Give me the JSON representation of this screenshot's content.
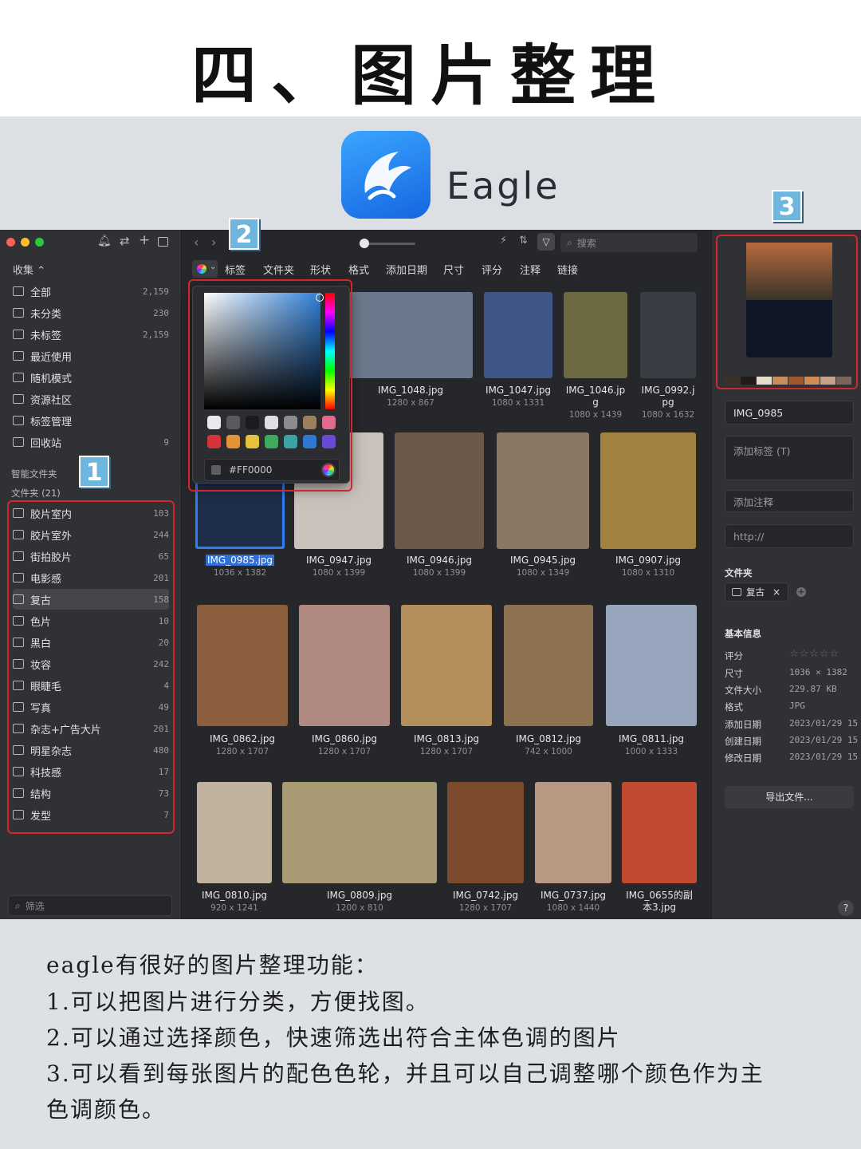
{
  "heading": "四、图片整理",
  "app_name": "Eagle",
  "badges": [
    "1",
    "2",
    "3"
  ],
  "toolbar": {
    "search_placeholder": "搜索"
  },
  "filters": [
    "标签",
    "文件夹",
    "形状",
    "格式",
    "添加日期",
    "尺寸",
    "评分",
    "注释",
    "链接"
  ],
  "color_picker": {
    "hex_value": "#FF0000",
    "swatches": [
      "#e9e9ea",
      "#595a5e",
      "#1c1c1e",
      "#dedfe1",
      "#8a8b8f",
      "#9c7f5c",
      "#e06a8c",
      "#d6343a",
      "#e39236",
      "#e6c23a",
      "#3eaa5d",
      "#3aa4a4",
      "#2f79d6",
      "#6a48d8"
    ]
  },
  "sidebar": {
    "collect_header": "收集",
    "items": [
      {
        "label": "全部",
        "count": "2,159"
      },
      {
        "label": "未分类",
        "count": "230"
      },
      {
        "label": "未标签",
        "count": "2,159"
      },
      {
        "label": "最近使用",
        "count": ""
      },
      {
        "label": "随机模式",
        "count": ""
      },
      {
        "label": "资源社区",
        "count": ""
      },
      {
        "label": "标签管理",
        "count": ""
      },
      {
        "label": "回收站",
        "count": "9"
      }
    ],
    "smart_folders": "智能文件夹",
    "folders_header": "文件夹 (21)",
    "folders": [
      {
        "label": "胶片室内",
        "count": "103"
      },
      {
        "label": "胶片室外",
        "count": "244"
      },
      {
        "label": "街拍胶片",
        "count": "65"
      },
      {
        "label": "电影感",
        "count": "201"
      },
      {
        "label": "复古",
        "count": "158"
      },
      {
        "label": "色片",
        "count": "10"
      },
      {
        "label": "黑白",
        "count": "20"
      },
      {
        "label": "妆容",
        "count": "242"
      },
      {
        "label": "眼睫毛",
        "count": "4"
      },
      {
        "label": "写真",
        "count": "49"
      },
      {
        "label": "杂志+广告大片",
        "count": "201"
      },
      {
        "label": "明星杂志",
        "count": "480"
      },
      {
        "label": "科技感",
        "count": "17"
      },
      {
        "label": "结构",
        "count": "73"
      },
      {
        "label": "发型",
        "count": "7"
      }
    ],
    "filter_placeholder": "筛选"
  },
  "grid": [
    {
      "name": "IMG_1048.jpg",
      "size": "1280 x 867",
      "color": "#6a7a8c"
    },
    {
      "name": "IMG_1047.jpg",
      "size": "1080 x 1331",
      "color": "#3e5585"
    },
    {
      "name": "IMG_1046.jp\ng",
      "size": "1080 x 1439",
      "color": "#6e6a42"
    },
    {
      "name": "IMG_0992.j\npg",
      "size": "1080 x 1632",
      "color": "#3a3d44"
    },
    {
      "name": "IMG_0985.jpg",
      "size": "1036 x 1382",
      "color": "#1e2d4a"
    },
    {
      "name": "IMG_0947.jpg",
      "size": "1080 x 1399",
      "color": "#c9c2bb"
    },
    {
      "name": "IMG_0946.jpg",
      "size": "1080 x 1399",
      "color": "#6b5a4b"
    },
    {
      "name": "IMG_0945.jpg",
      "size": "1080 x 1349",
      "color": "#8a7766"
    },
    {
      "name": "IMG_0907.jpg",
      "size": "1080 x 1310",
      "color": "#a0813f"
    },
    {
      "name": "IMG_0862.jpg",
      "size": "1280 x 1707",
      "color": "#8d5e3e"
    },
    {
      "name": "IMG_0860.jpg",
      "size": "1280 x 1707",
      "color": "#b08a80"
    },
    {
      "name": "IMG_0813.jpg",
      "size": "1280 x 1707",
      "color": "#b38e5a"
    },
    {
      "name": "IMG_0812.jpg",
      "size": "742 x 1000",
      "color": "#8c7250"
    },
    {
      "name": "IMG_0811.jpg",
      "size": "1000 x 1333",
      "color": "#97a6bd"
    },
    {
      "name": "IMG_0810.jpg",
      "size": "920 x 1241",
      "color": "#c1b29f"
    },
    {
      "name": "IMG_0809.jpg",
      "size": "1200 x 810",
      "color": "#a89a72"
    },
    {
      "name": "IMG_0742.jpg",
      "size": "1280 x 1707",
      "color": "#7c4b2e"
    },
    {
      "name": "IMG_0737.jpg",
      "size": "1080 x 1440",
      "color": "#b89783"
    },
    {
      "name": "IMG_0655的副\n本3.jpg",
      "size": "",
      "color": "#c04a32"
    }
  ],
  "inspector": {
    "palette": [
      "#3a3226",
      "#1f1c1a",
      "#e6dccd",
      "#c98d5c",
      "#a2562d",
      "#d48a55",
      "#c7a08a",
      "#7a6558"
    ],
    "name_value": "IMG_0985",
    "tags_placeholder": "添加标签 (T)",
    "notes_placeholder": "添加注释",
    "url_placeholder": "http://",
    "folder_header": "文件夹",
    "folder_chip": "复古",
    "chip_close": "×",
    "info_header": "基本信息",
    "info": [
      {
        "label": "评分",
        "value": "☆☆☆☆☆"
      },
      {
        "label": "尺寸",
        "value": "1036 × 1382"
      },
      {
        "label": "文件大小",
        "value": "229.87 KB"
      },
      {
        "label": "格式",
        "value": "JPG"
      },
      {
        "label": "添加日期",
        "value": "2023/01/29 15"
      },
      {
        "label": "创建日期",
        "value": "2023/01/29 15"
      },
      {
        "label": "修改日期",
        "value": "2023/01/29 15"
      }
    ],
    "export_label": "导出文件...",
    "help": "?"
  },
  "description": [
    "eagle有很好的图片整理功能：",
    "1.可以把图片进行分类，方便找图。",
    "2.可以通过选择颜色，快速筛选出符合主体色调的图片",
    "3.可以看到每张图片的配色色轮，并且可以自己调整哪个颜色作为主",
    "色调颜色。"
  ]
}
